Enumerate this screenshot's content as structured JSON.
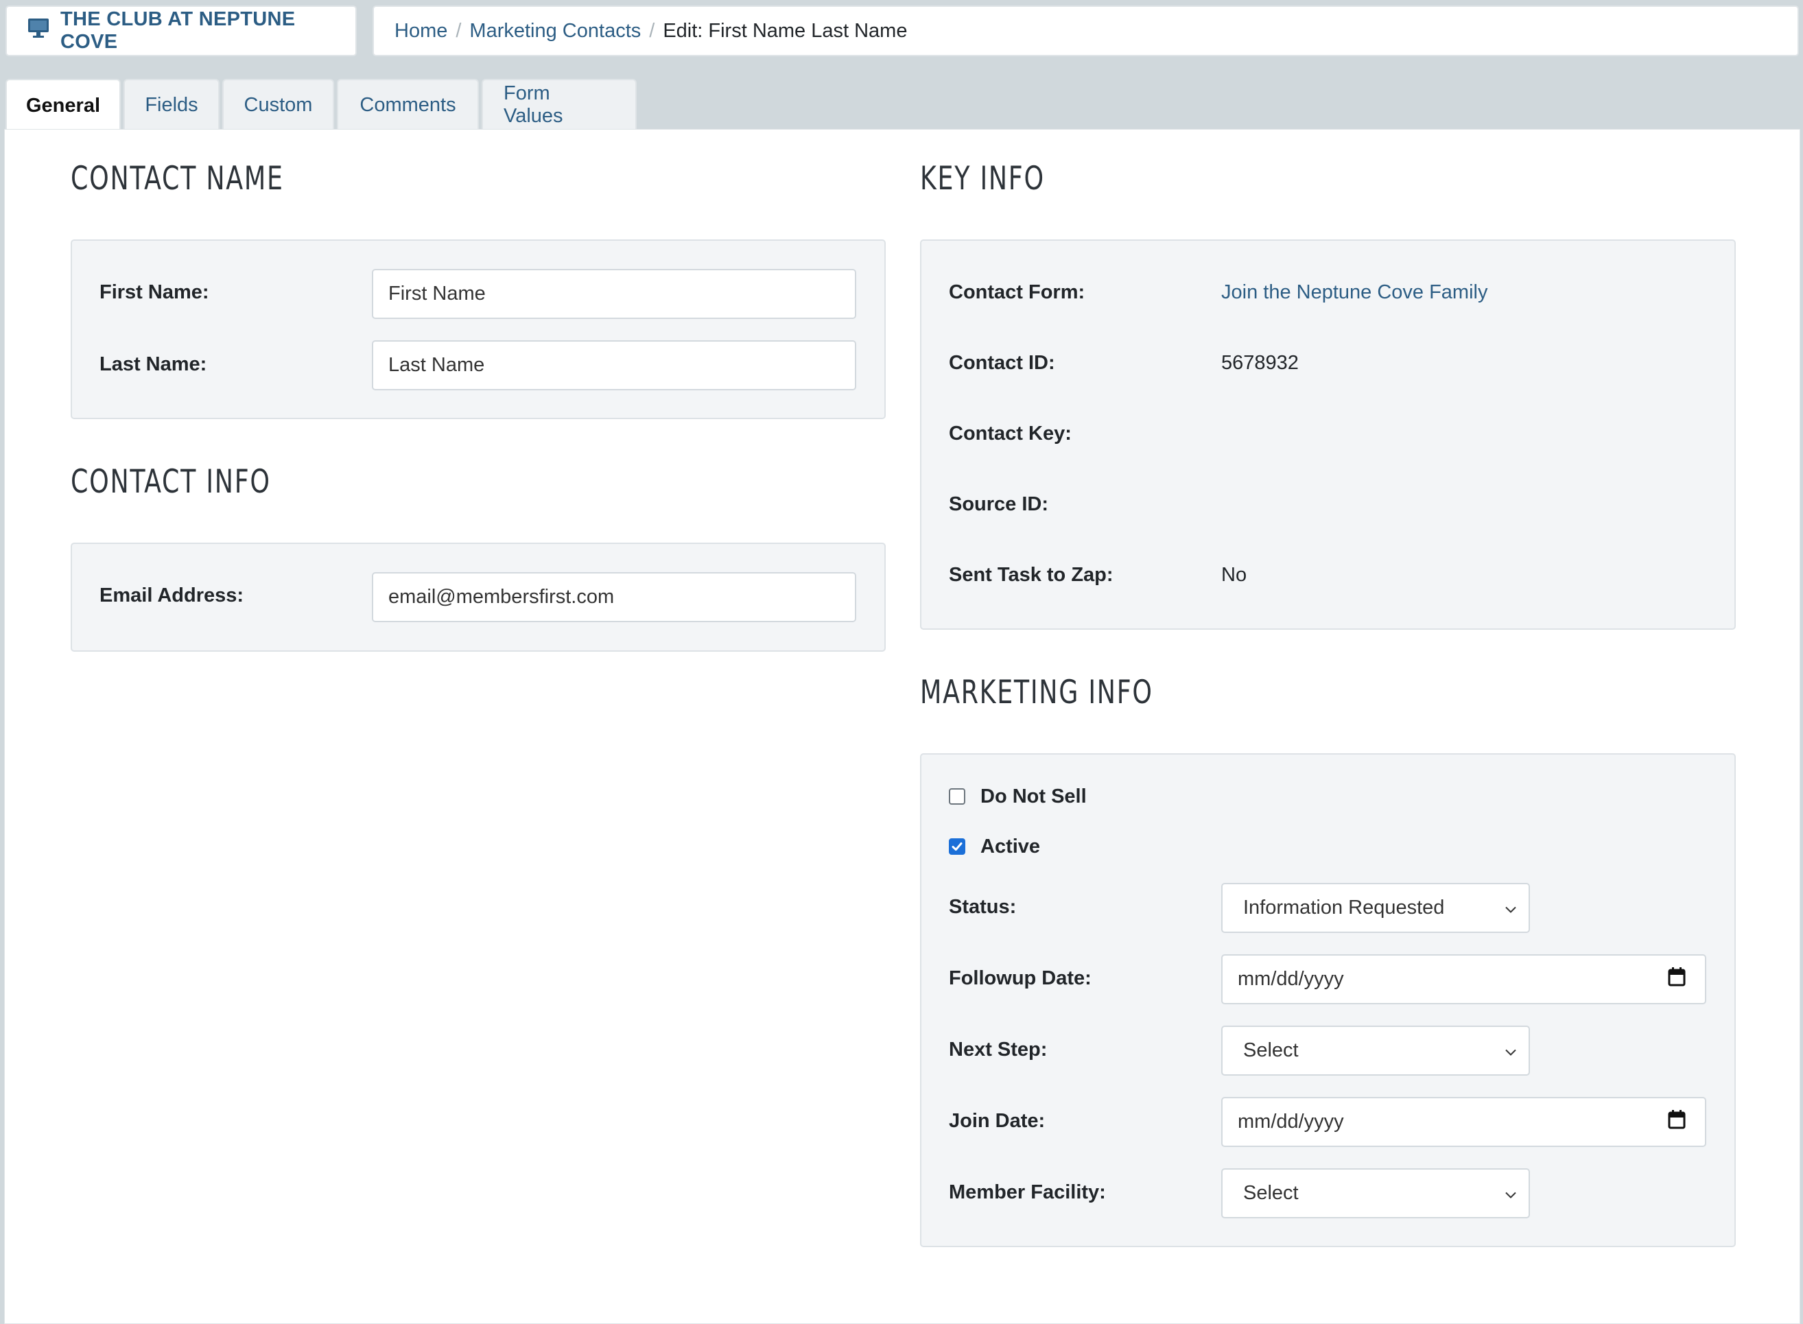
{
  "header": {
    "club_name": "THE CLUB AT NEPTUNE COVE",
    "breadcrumb": {
      "home": "Home",
      "section": "Marketing Contacts",
      "current": "Edit: First Name Last Name"
    }
  },
  "tabs": [
    {
      "label": "General",
      "active": true
    },
    {
      "label": "Fields"
    },
    {
      "label": "Custom"
    },
    {
      "label": "Comments"
    },
    {
      "label": "Form Values"
    }
  ],
  "contact_name": {
    "title": "CONTACT NAME",
    "first_name_label": "First Name:",
    "first_name_value": "First Name",
    "last_name_label": "Last Name:",
    "last_name_value": "Last Name"
  },
  "contact_info": {
    "title": "CONTACT INFO",
    "email_label": "Email Address:",
    "email_value": "email@membersfirst.com"
  },
  "key_info": {
    "title": "KEY INFO",
    "contact_form_label": "Contact Form:",
    "contact_form_value": "Join the Neptune Cove Family",
    "contact_id_label": "Contact ID:",
    "contact_id_value": "5678932",
    "contact_key_label": "Contact Key:",
    "source_id_label": "Source ID:",
    "sent_task_label": "Sent Task to Zap:",
    "sent_task_value": "No"
  },
  "marketing_info": {
    "title": "MARKETING INFO",
    "do_not_sell_label": "Do Not Sell",
    "do_not_sell_checked": false,
    "active_label": "Active",
    "active_checked": true,
    "status_label": "Status:",
    "status_value": "Information Requested",
    "followup_label": "Followup Date:",
    "followup_value": "mm/dd/yyyy",
    "next_step_label": "Next Step:",
    "next_step_value": "Select",
    "join_date_label": "Join Date:",
    "join_date_value": "mm/dd/yyyy",
    "member_facility_label": "Member Facility:",
    "member_facility_value": "Select"
  },
  "colors": {
    "accent": "#2c5d84",
    "checkbox": "#1b6fd8",
    "panel_bg": "#f3f5f7",
    "page_bg": "#d0d8dc"
  }
}
